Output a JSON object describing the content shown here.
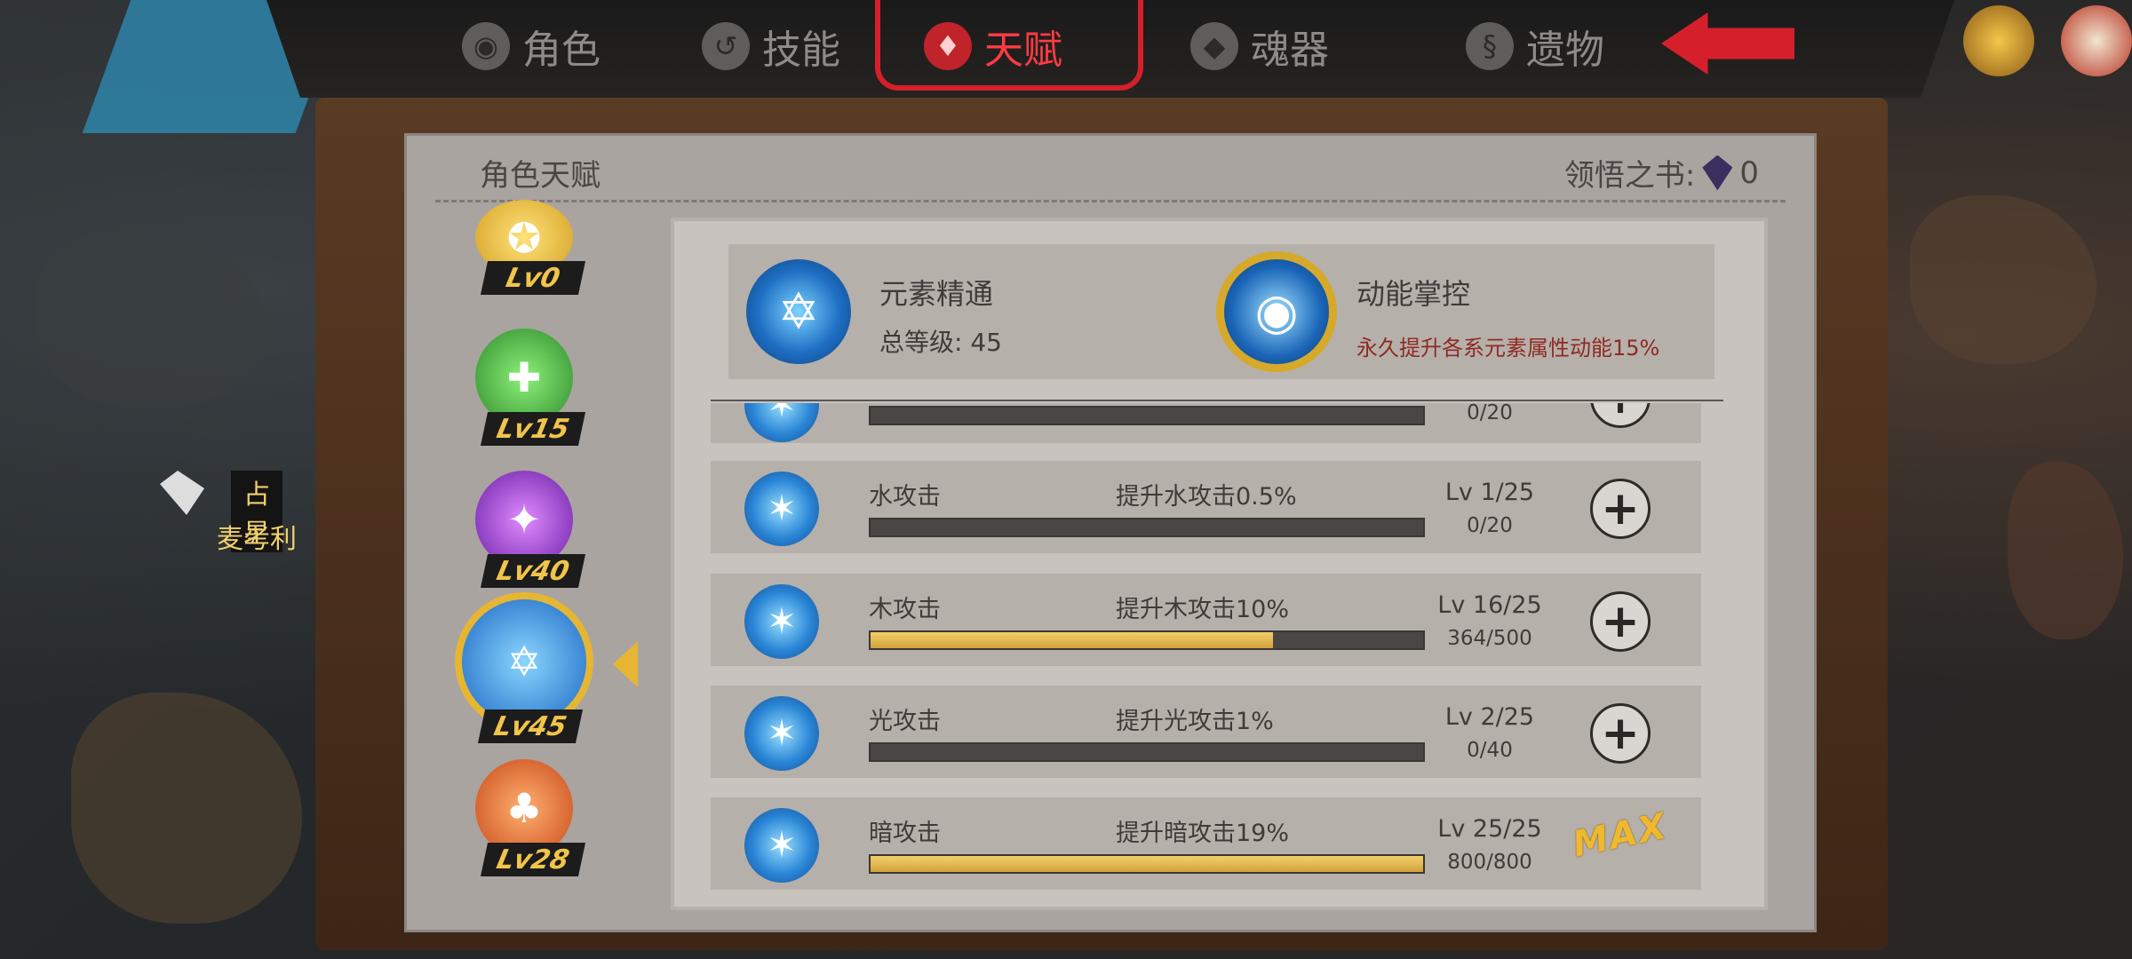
{
  "tabs": [
    {
      "label": "角色",
      "icon": "helmet-icon",
      "active": false
    },
    {
      "label": "技能",
      "icon": "swirl-icon",
      "active": false
    },
    {
      "label": "天赋",
      "icon": "talent-icon",
      "active": true
    },
    {
      "label": "魂器",
      "icon": "soul-icon",
      "active": false
    },
    {
      "label": "遗物",
      "icon": "relic-icon",
      "active": false
    }
  ],
  "character": {
    "title": "占星",
    "name": "麦考利"
  },
  "panel": {
    "title": "角色天赋",
    "book_label": "领悟之书:",
    "book_count": "0"
  },
  "elements": [
    {
      "level": "Lv0",
      "color": "#d5a225",
      "icon": "gold-element-icon"
    },
    {
      "level": "Lv15",
      "color": "#3da43a",
      "icon": "nature-element-icon"
    },
    {
      "level": "Lv40",
      "color": "#7a2bbd",
      "icon": "dark-element-icon"
    },
    {
      "level": "Lv45",
      "color": "#1f76d6",
      "icon": "water-element-icon",
      "selected": true
    },
    {
      "level": "Lv28",
      "color": "#d4501e",
      "icon": "fire-element-icon"
    }
  ],
  "summary": {
    "left": {
      "name": "元素精通",
      "total_label": "总等级:",
      "total_level": "45"
    },
    "right": {
      "name": "动能掌控",
      "desc": "永久提升各系元素属性动能15%"
    }
  },
  "rows": [
    {
      "name": "",
      "desc": "",
      "level": "",
      "xp": "0/20",
      "progress": 0,
      "max": false,
      "partial": true
    },
    {
      "name": "水攻击",
      "desc": "提升水攻击0.5%",
      "level": "Lv 1/25",
      "xp": "0/20",
      "progress": 0,
      "max": false
    },
    {
      "name": "木攻击",
      "desc": "提升木攻击10%",
      "level": "Lv 16/25",
      "xp": "364/500",
      "progress": 0.728,
      "max": false
    },
    {
      "name": "光攻击",
      "desc": "提升光攻击1%",
      "level": "Lv 2/25",
      "xp": "0/40",
      "progress": 0,
      "max": false
    },
    {
      "name": "暗攻击",
      "desc": "提升暗攻击19%",
      "level": "Lv 25/25",
      "xp": "800/800",
      "progress": 1,
      "max": true,
      "max_label": "MAX"
    }
  ],
  "colors": {
    "accent": "#d5202b",
    "gold": "#e6b633",
    "panel": "#aaa4a0"
  }
}
